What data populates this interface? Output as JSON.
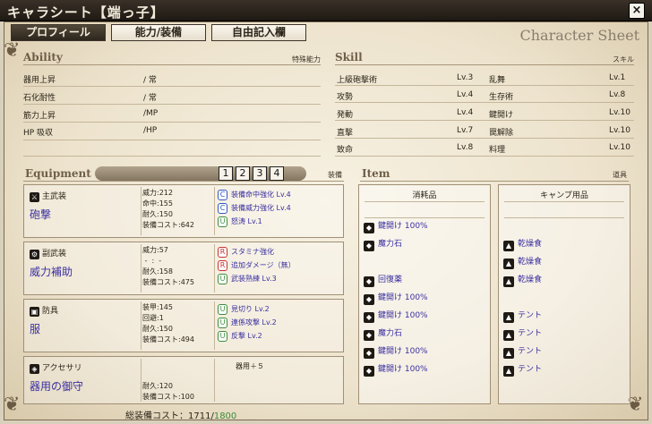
{
  "window": {
    "title": "キャラシート【端っ子】",
    "close_label": "×"
  },
  "tabs": [
    {
      "label": "プロフィール"
    },
    {
      "label": "能力/装備"
    },
    {
      "label": "自由記入欄"
    }
  ],
  "header_right": "Character Sheet",
  "ability": {
    "title": "Ability",
    "subtitle": "特殊能力",
    "rows": [
      {
        "name": "器用上昇",
        "value": "/ 常"
      },
      {
        "name": "石化耐性",
        "value": "/ 常"
      },
      {
        "name": "筋力上昇",
        "value": "/MP"
      },
      {
        "name": "HP 吸収",
        "value": "/HP"
      }
    ]
  },
  "skill": {
    "title": "Skill",
    "subtitle": "スキル",
    "left": [
      {
        "name": "上級砲撃術",
        "level": "Lv.3"
      },
      {
        "name": "攻勢",
        "level": "Lv.4"
      },
      {
        "name": "発動",
        "level": "Lv.4"
      },
      {
        "name": "直撃",
        "level": "Lv.7"
      },
      {
        "name": "致命",
        "level": "Lv.8"
      }
    ],
    "right": [
      {
        "name": "乱舞",
        "level": "Lv.1"
      },
      {
        "name": "生存術",
        "level": "Lv.8"
      },
      {
        "name": "鍵開け",
        "level": "Lv.10"
      },
      {
        "name": "罠解除",
        "level": "Lv.10"
      },
      {
        "name": "料理",
        "level": "Lv.10"
      }
    ]
  },
  "equipment": {
    "title": "Equipment",
    "subtitle": "装備",
    "pages": [
      "1",
      "2",
      "3",
      "4"
    ],
    "slots": [
      {
        "slot": "主武装",
        "icon": "sword-icon",
        "name": "砲撃",
        "stats": "威力:212\n命中:155\n耐久:150\n装備コスト:642",
        "skills": [
          {
            "badge": "C",
            "text": "装備命中強化 Lv.4"
          },
          {
            "badge": "C",
            "text": "装備威力強化 Lv.4"
          },
          {
            "badge": "U",
            "text": "怒涛 Lv.1"
          }
        ]
      },
      {
        "slot": "副武装",
        "icon": "gear-icon",
        "name": "威力補助",
        "stats": "威力:57\n -  :  -\n耐久:158\n装備コスト:475",
        "skills": [
          {
            "badge": "R",
            "text": "スタミナ強化"
          },
          {
            "badge": "R",
            "text": "追加ダメージ（無）"
          },
          {
            "badge": "U",
            "text": "武装熟練 Lv.3"
          }
        ]
      },
      {
        "slot": "防具",
        "icon": "armor-icon",
        "name": "服",
        "stats": "装甲:145\n回避:1\n耐久:150\n装備コスト:494",
        "skills": [
          {
            "badge": "U",
            "text": "見切り Lv.2"
          },
          {
            "badge": "U",
            "text": "連係攻撃 Lv.2"
          },
          {
            "badge": "U",
            "text": "反撃 Lv.2"
          }
        ]
      },
      {
        "slot": "アクセサリ",
        "icon": "accessory-icon",
        "name": "器用の御守",
        "stats": "\n\n耐久:120\n装備コスト:100",
        "skills": [
          {
            "badge": "",
            "text": "器用＋５"
          }
        ]
      }
    ],
    "total_label": "総装備コスト：",
    "total_cost": "1711",
    "total_max": "1800"
  },
  "items": {
    "title": "Item",
    "subtitle": "道具",
    "consumables_header": "消耗品",
    "camp_header": "キャンプ用品",
    "consumables": [
      "鍵開け 100%",
      "魔力石",
      "",
      "回復薬",
      "鍵開け 100%",
      "鍵開け 100%",
      "魔力石",
      "鍵開け 100%",
      "鍵開け 100%"
    ],
    "camp": [
      "",
      "乾燥食",
      "乾燥食",
      "乾燥食",
      "",
      "テント",
      "テント",
      "テント",
      "テント"
    ]
  },
  "colors": {
    "accent_blue": "#3a2fa0",
    "green": "#3c8c3c",
    "red": "#c73030"
  }
}
